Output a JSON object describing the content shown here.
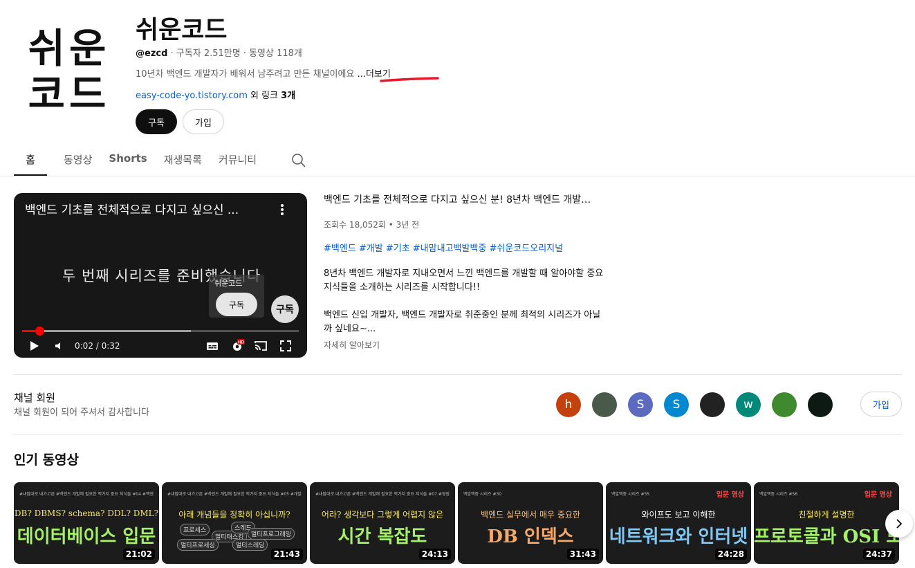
{
  "channel": {
    "logo_line1": "쉬운",
    "logo_line2": "코드",
    "name": "쉬운코드",
    "handle": "@ezcd",
    "meta_rest": " · 구독자 2.51만명 · 동영상 118개",
    "description": "10년차 백엔드 개발자가 배워서 남주려고 만든 채널이에요 ",
    "more_label": "...더보기",
    "link_url": "easy-code-yo.tistory.com",
    "link_rest_prefix": " 외 링크 ",
    "link_rest_count": "3개",
    "subscribe_label": "구독",
    "join_label": "가입",
    "underline_color": "#e8192c"
  },
  "tabs": [
    {
      "label": "홈",
      "active": true
    },
    {
      "label": "동영상"
    },
    {
      "label": "Shorts"
    },
    {
      "label": "재생목록"
    },
    {
      "label": "커뮤니티"
    }
  ],
  "player": {
    "overlay_title": "백엔드 기초를 전체적으로 다지고 싶으신 ...",
    "caption": "두 번째 시리즈를 준비했습니다",
    "card_name": "쉬운코드",
    "card_subscribe": "구독",
    "watermark": "구독",
    "time": "0:02 / 0:32",
    "progress_fraction": 0.0625,
    "buffer_fraction": 0.61,
    "hd_badge": "HD",
    "accent": "#ff0000"
  },
  "featured": {
    "title": "백엔드 기초를 전체적으로 다지고 싶으신 분! 8년차 백엔드 개발…",
    "stats": "조회수 18,052회 • 3년 전",
    "tags": "#백엔드 #개발 #기초 #내맘내고백발백중 #쉬운코드오리지널",
    "desc_p1": "8년차 백엔드 개발자로 지내오면서 느낀 백엔드를 개발할 때 알아야할 중요 지식들을 소개하는 시리즈를 시작합니다!!",
    "desc_p2": "백엔드 신입 개발자, 백엔드 개발자로 취준중인 분께 최적의 시리즈가 아닐까 싶네요~...",
    "more": "자세히 알아보기"
  },
  "members": {
    "title": "채널 회원",
    "subtitle": "채널 회원이 되어 주셔서 감사합니다",
    "join_label": "가입",
    "avatars": [
      {
        "letter": "h",
        "color": "#c2410c"
      },
      {
        "letter": "",
        "color": "#4a5a4a"
      },
      {
        "letter": "S",
        "color": "#5c6bc0"
      },
      {
        "letter": "S",
        "color": "#0288d1"
      },
      {
        "letter": "",
        "color": "#222222"
      },
      {
        "letter": "w",
        "color": "#00897b"
      },
      {
        "letter": "",
        "color": "#3f8a2e"
      },
      {
        "letter": "",
        "color": "#0d1a14"
      }
    ]
  },
  "popular": {
    "title": "인기 동영상",
    "videos": [
      {
        "tiny": "#내맘대로 내가고른  #백엔드 개발에 필요한 백가지 중요 지식들  #04  #백엔드에서 감사  #데이터베이스  #존중하며 읽는 기분",
        "line1": "DB? DBMS? schema? DDL? DML?",
        "line2": "데이터베이스 입문",
        "duration": "21:02",
        "line1_color": "#f5e663",
        "line2_color": "#a4f06a",
        "badge": ""
      },
      {
        "tiny": "#내맘대로 내가고른  #백엔드 개발에 필요한 백가지 중요 지식들  #05  #개발자면 만점필수  #한번 창의  #통일된 예제",
        "line1": "아래 개념들을 정확히 아십니까?",
        "line2": "",
        "duration": "21:43",
        "line1_color": "#f5e663",
        "line2_color": "#ffffff",
        "badge": ""
      },
      {
        "tiny": "#내맘대로 내가고른  #백엔드 개발에 필요한 백가지 중요 지식들  #07  #영원 변경  #쉬운코드만큼 친한 만들면 생명",
        "line1": "어라? 생각보다 그렇게 어렵지 않은",
        "line2": "시간 복잡도",
        "duration": "24:13",
        "line1_color": "#f5e663",
        "line2_color": "#a4f06a",
        "badge": ""
      },
      {
        "tiny": "백발백중 시리즈  #30",
        "line1": "백엔드 실무에서 매우 중요한",
        "line2": "DB 인덱스",
        "duration": "31:43",
        "line1_color": "#f5c07a",
        "line2_color": "#f5a86a",
        "badge": ""
      },
      {
        "tiny": "백발백중 시리즈  #55",
        "line1": "와이프도 보고 이해한",
        "line2": "네트워크와 인터넷",
        "duration": "24:28",
        "line1_color": "#ffffff",
        "line2_color": "#7ec8f5",
        "badge": "입문 영상"
      },
      {
        "tiny": "백발백중 시리즈  #56",
        "line1": "친절하게 설명한",
        "line2": "프로토콜과 OSI 모델",
        "duration": "24:37",
        "line1_color": "#f5e663",
        "line2_color": "#a4f06a",
        "badge": "입문 영상"
      }
    ],
    "thumb2_pills": [
      "프로세스",
      "멀티태스킹",
      "스레드",
      "멀티프로그래밍",
      "멀티프로세싱",
      "멀티스레딩"
    ]
  }
}
